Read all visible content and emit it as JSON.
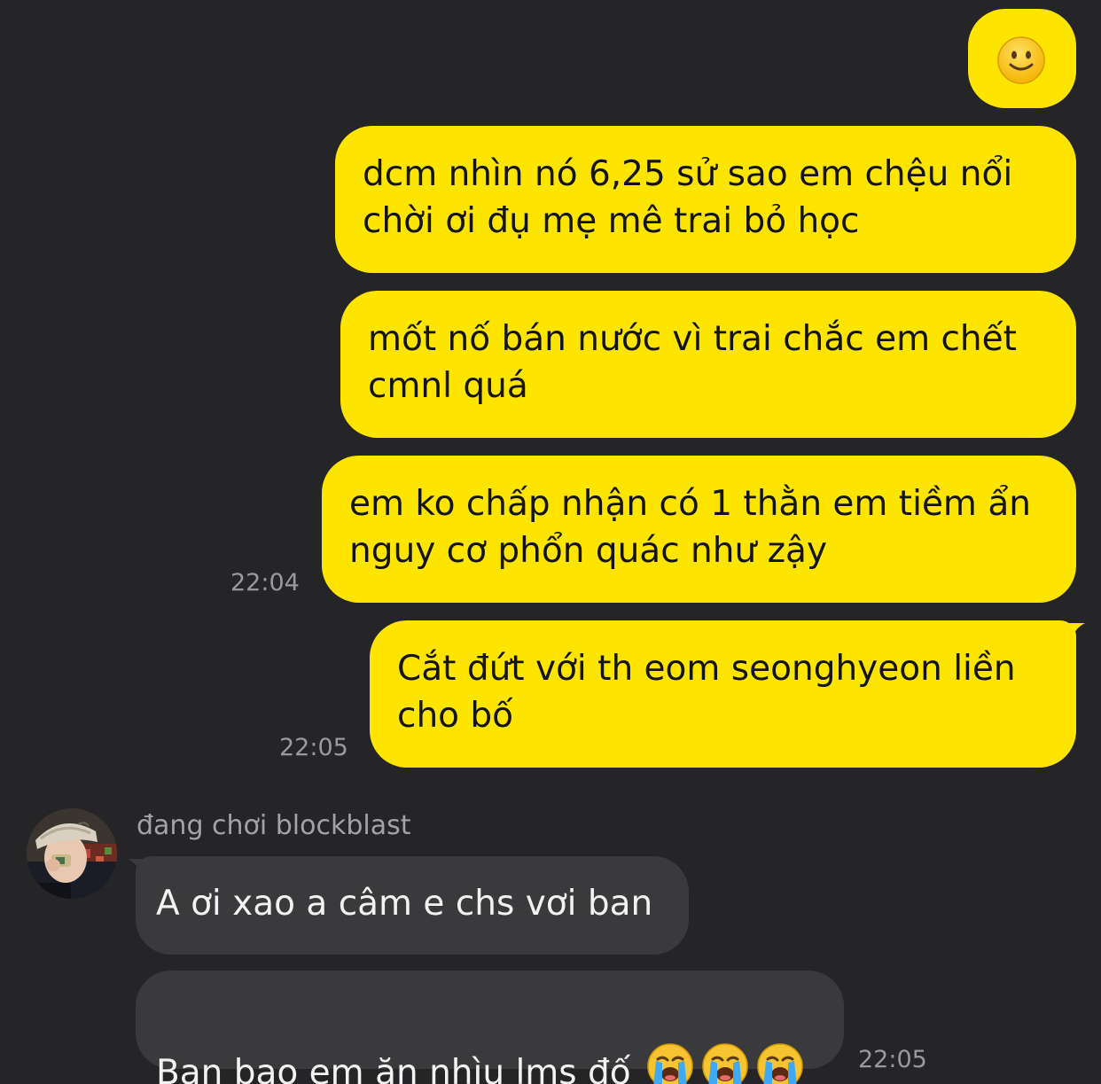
{
  "colors": {
    "background": "#252527",
    "outgoing_bubble": "#FEE500",
    "incoming_bubble": "#3A3A3C",
    "timestamp": "#9A9A9E"
  },
  "conversation": {
    "outgoing": [
      {
        "icon": "slightly-smiling-face-icon"
      },
      {
        "text": "dcm nhìn nó 6,25 sử sao em chệu nổi\nchời ơi đụ mẹ mê trai bỏ học"
      },
      {
        "text": "mốt nố bán nước vì trai chắc em chết\ncmnl quá"
      },
      {
        "text": "em ko chấp nhận có 1 thằn em tiềm ẩn\nnguy cơ phổn quác như zậy",
        "time": "22:04"
      },
      {
        "text": "Cắt đứt với th eom seonghyeon liền\ncho bố",
        "time": "22:05"
      }
    ],
    "incoming": {
      "sender_status": "đang chơi blockblast",
      "messages": [
        {
          "text": "A ơi xao a câm e chs vơi ban"
        },
        {
          "text": "Ban bao em ăn nhìu lms đố",
          "emojis": [
            "loudly-crying-face-icon",
            "loudly-crying-face-icon",
            "loudly-crying-face-icon"
          ],
          "time": "22:05"
        }
      ]
    }
  }
}
